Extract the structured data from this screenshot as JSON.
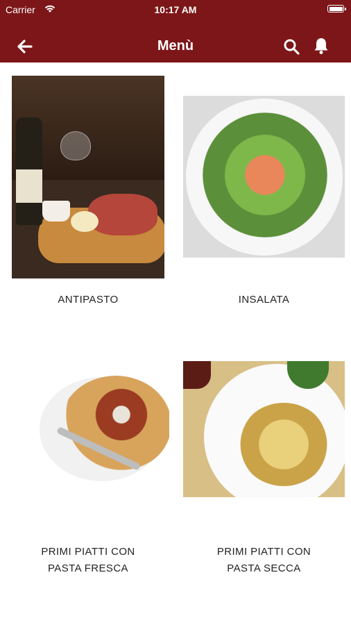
{
  "status_bar": {
    "carrier": "Carrier",
    "time": "10:17 AM"
  },
  "header": {
    "title": "Menù",
    "background_color": "#7d1618"
  },
  "menu_items": [
    {
      "label": "ANTIPASTO"
    },
    {
      "label": "INSALATA"
    },
    {
      "label_line1": "PRIMI PIATTI CON",
      "label_line2": "PASTA FRESCA"
    },
    {
      "label_line1": "PRIMI PIATTI CON",
      "label_line2": "PASTA SECCA"
    }
  ]
}
